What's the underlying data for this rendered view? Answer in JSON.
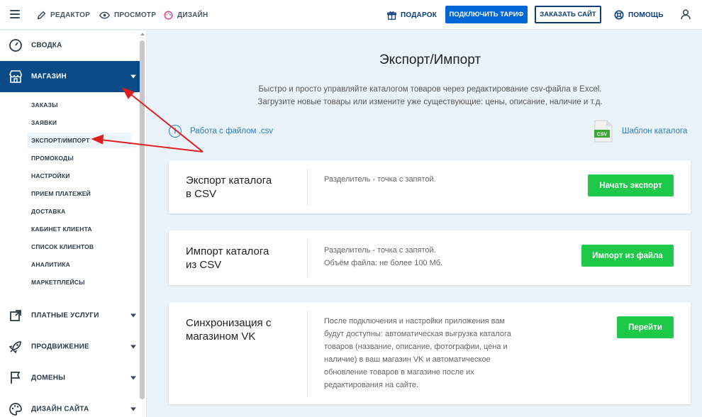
{
  "topbar": {
    "editor": "РЕДАКТОР",
    "preview": "ПРОСМОТР",
    "design": "ДИЗАЙН",
    "gift": "ПОДАРОК",
    "connect_tariff": "ПОДКЛЮЧИТЬ ТАРИФ",
    "order_site": "ЗАКАЗАТЬ САЙТ",
    "help": "ПОМОЩЬ"
  },
  "sidebar": {
    "summary": "СВОДКА",
    "shop": "МАГАЗИН",
    "shop_items": [
      "ЗАКАЗЫ",
      "ЗАЯВКИ",
      "ЭКСПОРТ/ИМПОРТ",
      "ПРОМОКОДЫ",
      "НАСТРОЙКИ",
      "ПРИЕМ ПЛАТЕЖЕЙ",
      "ДОСТАВКА",
      "КАБИНЕТ КЛИЕНТА",
      "СПИСОК КЛИЕНТОВ",
      "АНАЛИТИКА",
      "МАРКЕТПЛЕЙСЫ"
    ],
    "paid_services": "ПЛАТНЫЕ УСЛУГИ",
    "promotion": "ПРОДВИЖЕНИЕ",
    "domains": "ДОМЕНЫ",
    "site_design": "ДИЗАЙН САЙТА"
  },
  "main": {
    "title": "Экспорт/Импорт",
    "desc_line1": "Быстро и просто управляйте каталогом товаров через редактирование csv-файла в Excel.",
    "desc_line2": "Загрузите новые товары или измените уже существующие: цены, описание, наличие и т.д.",
    "help_link": "Работа с файлом .csv",
    "help_icon_text": "!",
    "template_link": "Шаблон каталога",
    "csv_icon_text": "CSV",
    "cards": [
      {
        "title_l1": "Экспорт каталога",
        "title_l2": "в CSV",
        "text_l1": "Разделитель - точка с запятой.",
        "button": "Начать экспорт"
      },
      {
        "title_l1": "Импорт каталога",
        "title_l2": "из CSV",
        "text_l1": "Разделитель - точка с запятой.",
        "text_l2": "Объём файла: не более 100 Мб.",
        "button": "Импорт из файла"
      },
      {
        "title_l1": "Синхронизация с",
        "title_l2": "магазином VK",
        "text_lines": [
          "После подключения и настройки приложения вам",
          "будут доступны: автоматическая выгрузка каталога",
          "товаров (название, описание, фотографии, цена и",
          "наличие) в ваш магазин VK и автоматическое",
          "обновление товаров в магазине после их",
          "редактирования на сайте."
        ],
        "button": "Перейти"
      }
    ]
  },
  "colors": {
    "brand_blue": "#0068d6",
    "sidebar_active": "#0a4a87",
    "green_button": "#1ec94a",
    "link_blue": "#2f7bbf",
    "annotation_red": "#e02020"
  }
}
